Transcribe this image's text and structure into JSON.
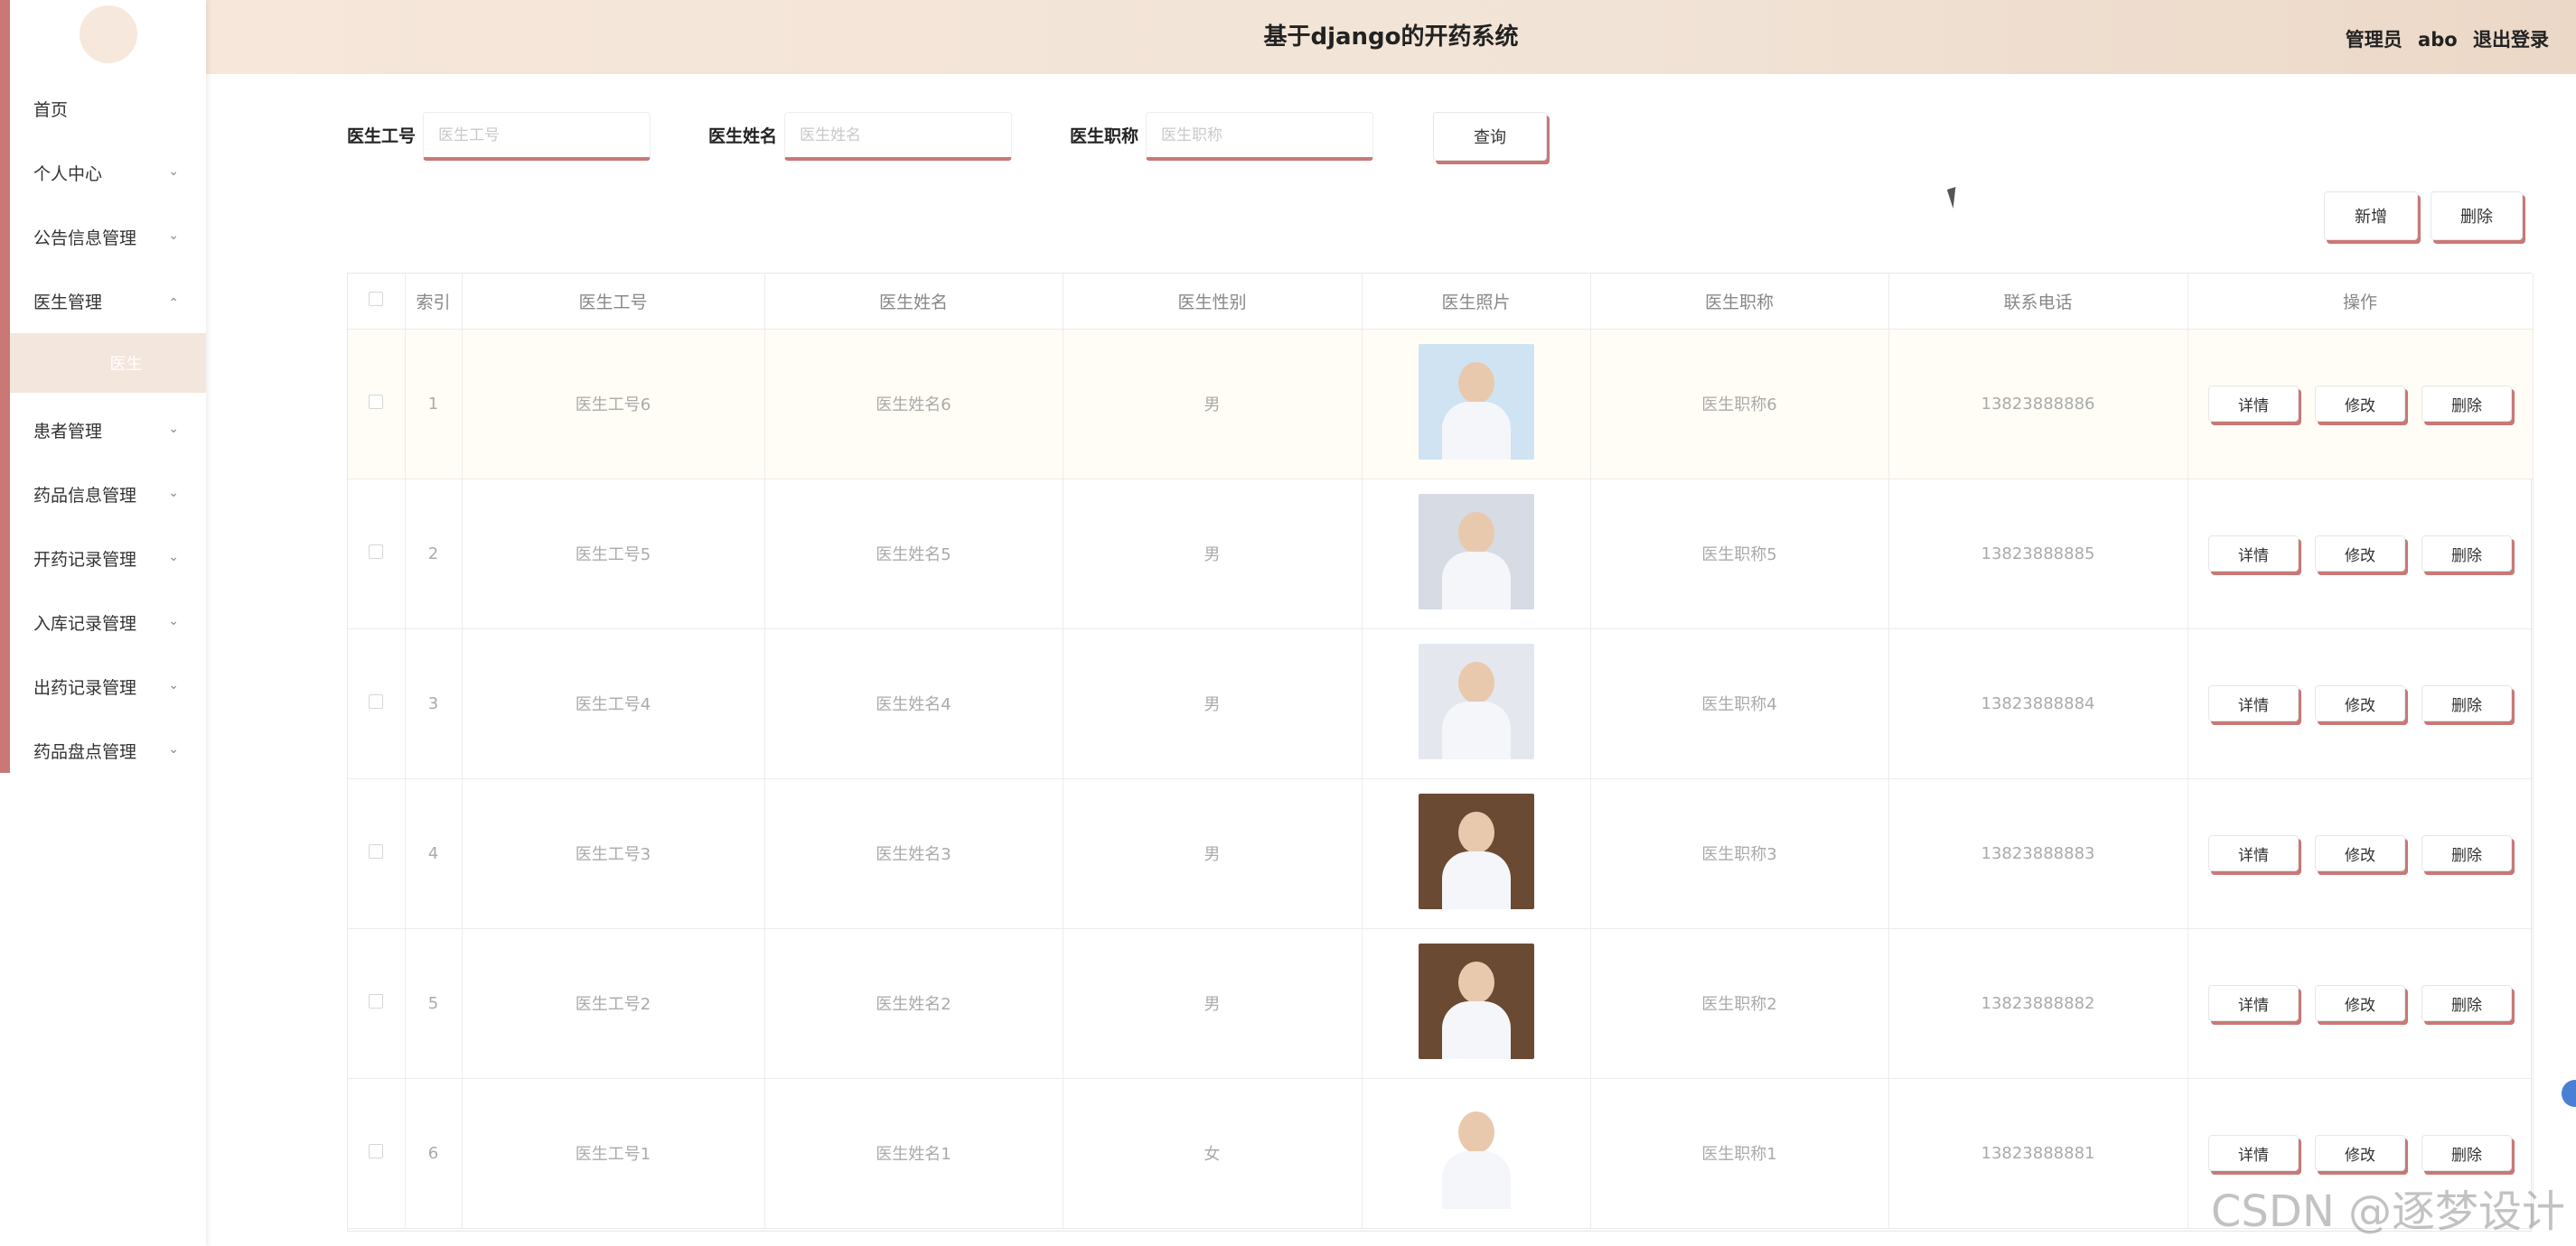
{
  "app": {
    "title": "基于django的开药系统",
    "user_role": "管理员",
    "user_name": "abo",
    "logout_label": "退出登录"
  },
  "sidebar": {
    "items": [
      {
        "label": "首页",
        "has_chevron": false
      },
      {
        "label": "个人中心",
        "has_chevron": true
      },
      {
        "label": "公告信息管理",
        "has_chevron": true
      },
      {
        "label": "医生管理",
        "has_chevron": true,
        "expanded": true
      },
      {
        "label": "患者管理",
        "has_chevron": true
      },
      {
        "label": "药品信息管理",
        "has_chevron": true
      },
      {
        "label": "开药记录管理",
        "has_chevron": true
      },
      {
        "label": "入库记录管理",
        "has_chevron": true
      },
      {
        "label": "出药记录管理",
        "has_chevron": true
      },
      {
        "label": "药品盘点管理",
        "has_chevron": true
      }
    ],
    "sub_item": "医生",
    "chevron_down": "⌄",
    "chevron_up": "⌃"
  },
  "search": {
    "fields": [
      {
        "label": "医生工号",
        "placeholder": "医生工号",
        "value": ""
      },
      {
        "label": "医生姓名",
        "placeholder": "医生姓名",
        "value": ""
      },
      {
        "label": "医生职称",
        "placeholder": "医生职称",
        "value": ""
      }
    ],
    "query_label": "查询"
  },
  "toolbar": {
    "add_label": "新增",
    "delete_label": "删除"
  },
  "table": {
    "columns": [
      "",
      "索引",
      "医生工号",
      "医生姓名",
      "医生性别",
      "医生照片",
      "医生职称",
      "联系电话",
      "操作"
    ],
    "rows": [
      {
        "index": "1",
        "doc_id": "医生工号6",
        "name": "医生姓名6",
        "gender": "男",
        "title": "医生职称6",
        "phone": "13823888886"
      },
      {
        "index": "2",
        "doc_id": "医生工号5",
        "name": "医生姓名5",
        "gender": "男",
        "title": "医生职称5",
        "phone": "13823888885"
      },
      {
        "index": "3",
        "doc_id": "医生工号4",
        "name": "医生姓名4",
        "gender": "男",
        "title": "医生职称4",
        "phone": "13823888884"
      },
      {
        "index": "4",
        "doc_id": "医生工号3",
        "name": "医生姓名3",
        "gender": "男",
        "title": "医生职称3",
        "phone": "13823888883"
      },
      {
        "index": "5",
        "doc_id": "医生工号2",
        "name": "医生姓名2",
        "gender": "男",
        "title": "医生职称2",
        "phone": "13823888882"
      },
      {
        "index": "6",
        "doc_id": "医生工号1",
        "name": "医生姓名1",
        "gender": "女",
        "title": "医生职称1",
        "phone": "13823888881"
      }
    ],
    "actions": {
      "detail": "详情",
      "edit": "修改",
      "delete": "删除"
    }
  },
  "photos": [
    {
      "bg": "#cfe3f2"
    },
    {
      "bg": "#d6dbe4"
    },
    {
      "bg": "#e4e8ee"
    },
    {
      "bg": "#6b4a33"
    },
    {
      "bg": "#6b4a33"
    },
    {
      "bg": "#ffffff"
    }
  ],
  "watermark": "CSDN @逐梦设计",
  "colors": {
    "accent": "#c97876",
    "header_bg": "#f3e4d7",
    "submenu_bg": "#f3e6dc"
  }
}
